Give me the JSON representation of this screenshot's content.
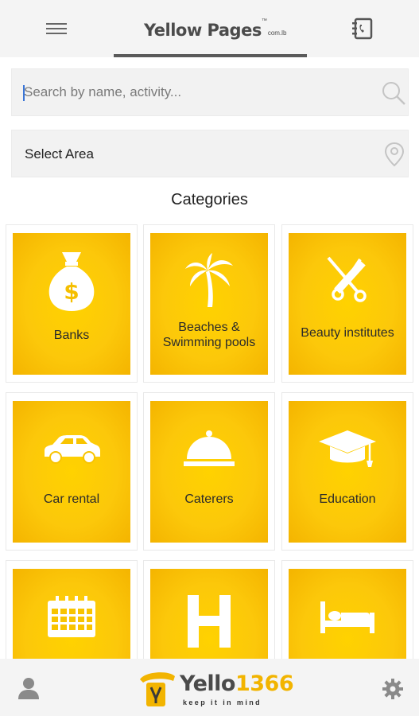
{
  "header": {
    "logo_main": "Yellow Pages",
    "logo_tm": "™",
    "logo_sub": "com.lb"
  },
  "search": {
    "placeholder": "Search by name, activity...",
    "value": ""
  },
  "area": {
    "label": "Select Area"
  },
  "categories_title": "Categories",
  "categories": [
    {
      "label": "Banks",
      "icon": "money-bag-icon"
    },
    {
      "label": "Beaches & Swimming pools",
      "icon": "palm-tree-icon"
    },
    {
      "label": "Beauty institutes",
      "icon": "scissors-comb-icon"
    },
    {
      "label": "Car rental",
      "icon": "car-icon"
    },
    {
      "label": "Caterers",
      "icon": "cloche-icon"
    },
    {
      "label": "Education",
      "icon": "graduation-cap-icon"
    },
    {
      "label": "",
      "icon": "calendar-icon"
    },
    {
      "label": "",
      "icon": "hotel-h-icon"
    },
    {
      "label": "",
      "icon": "bed-icon"
    }
  ],
  "footer": {
    "brand_word": "Yello",
    "brand_number": "1366",
    "tagline": "keep it in mind"
  },
  "colors": {
    "tile_yellow": "#fcc80a",
    "brand_yellow": "#f2b400",
    "bar_gray": "#f4f4f4"
  }
}
